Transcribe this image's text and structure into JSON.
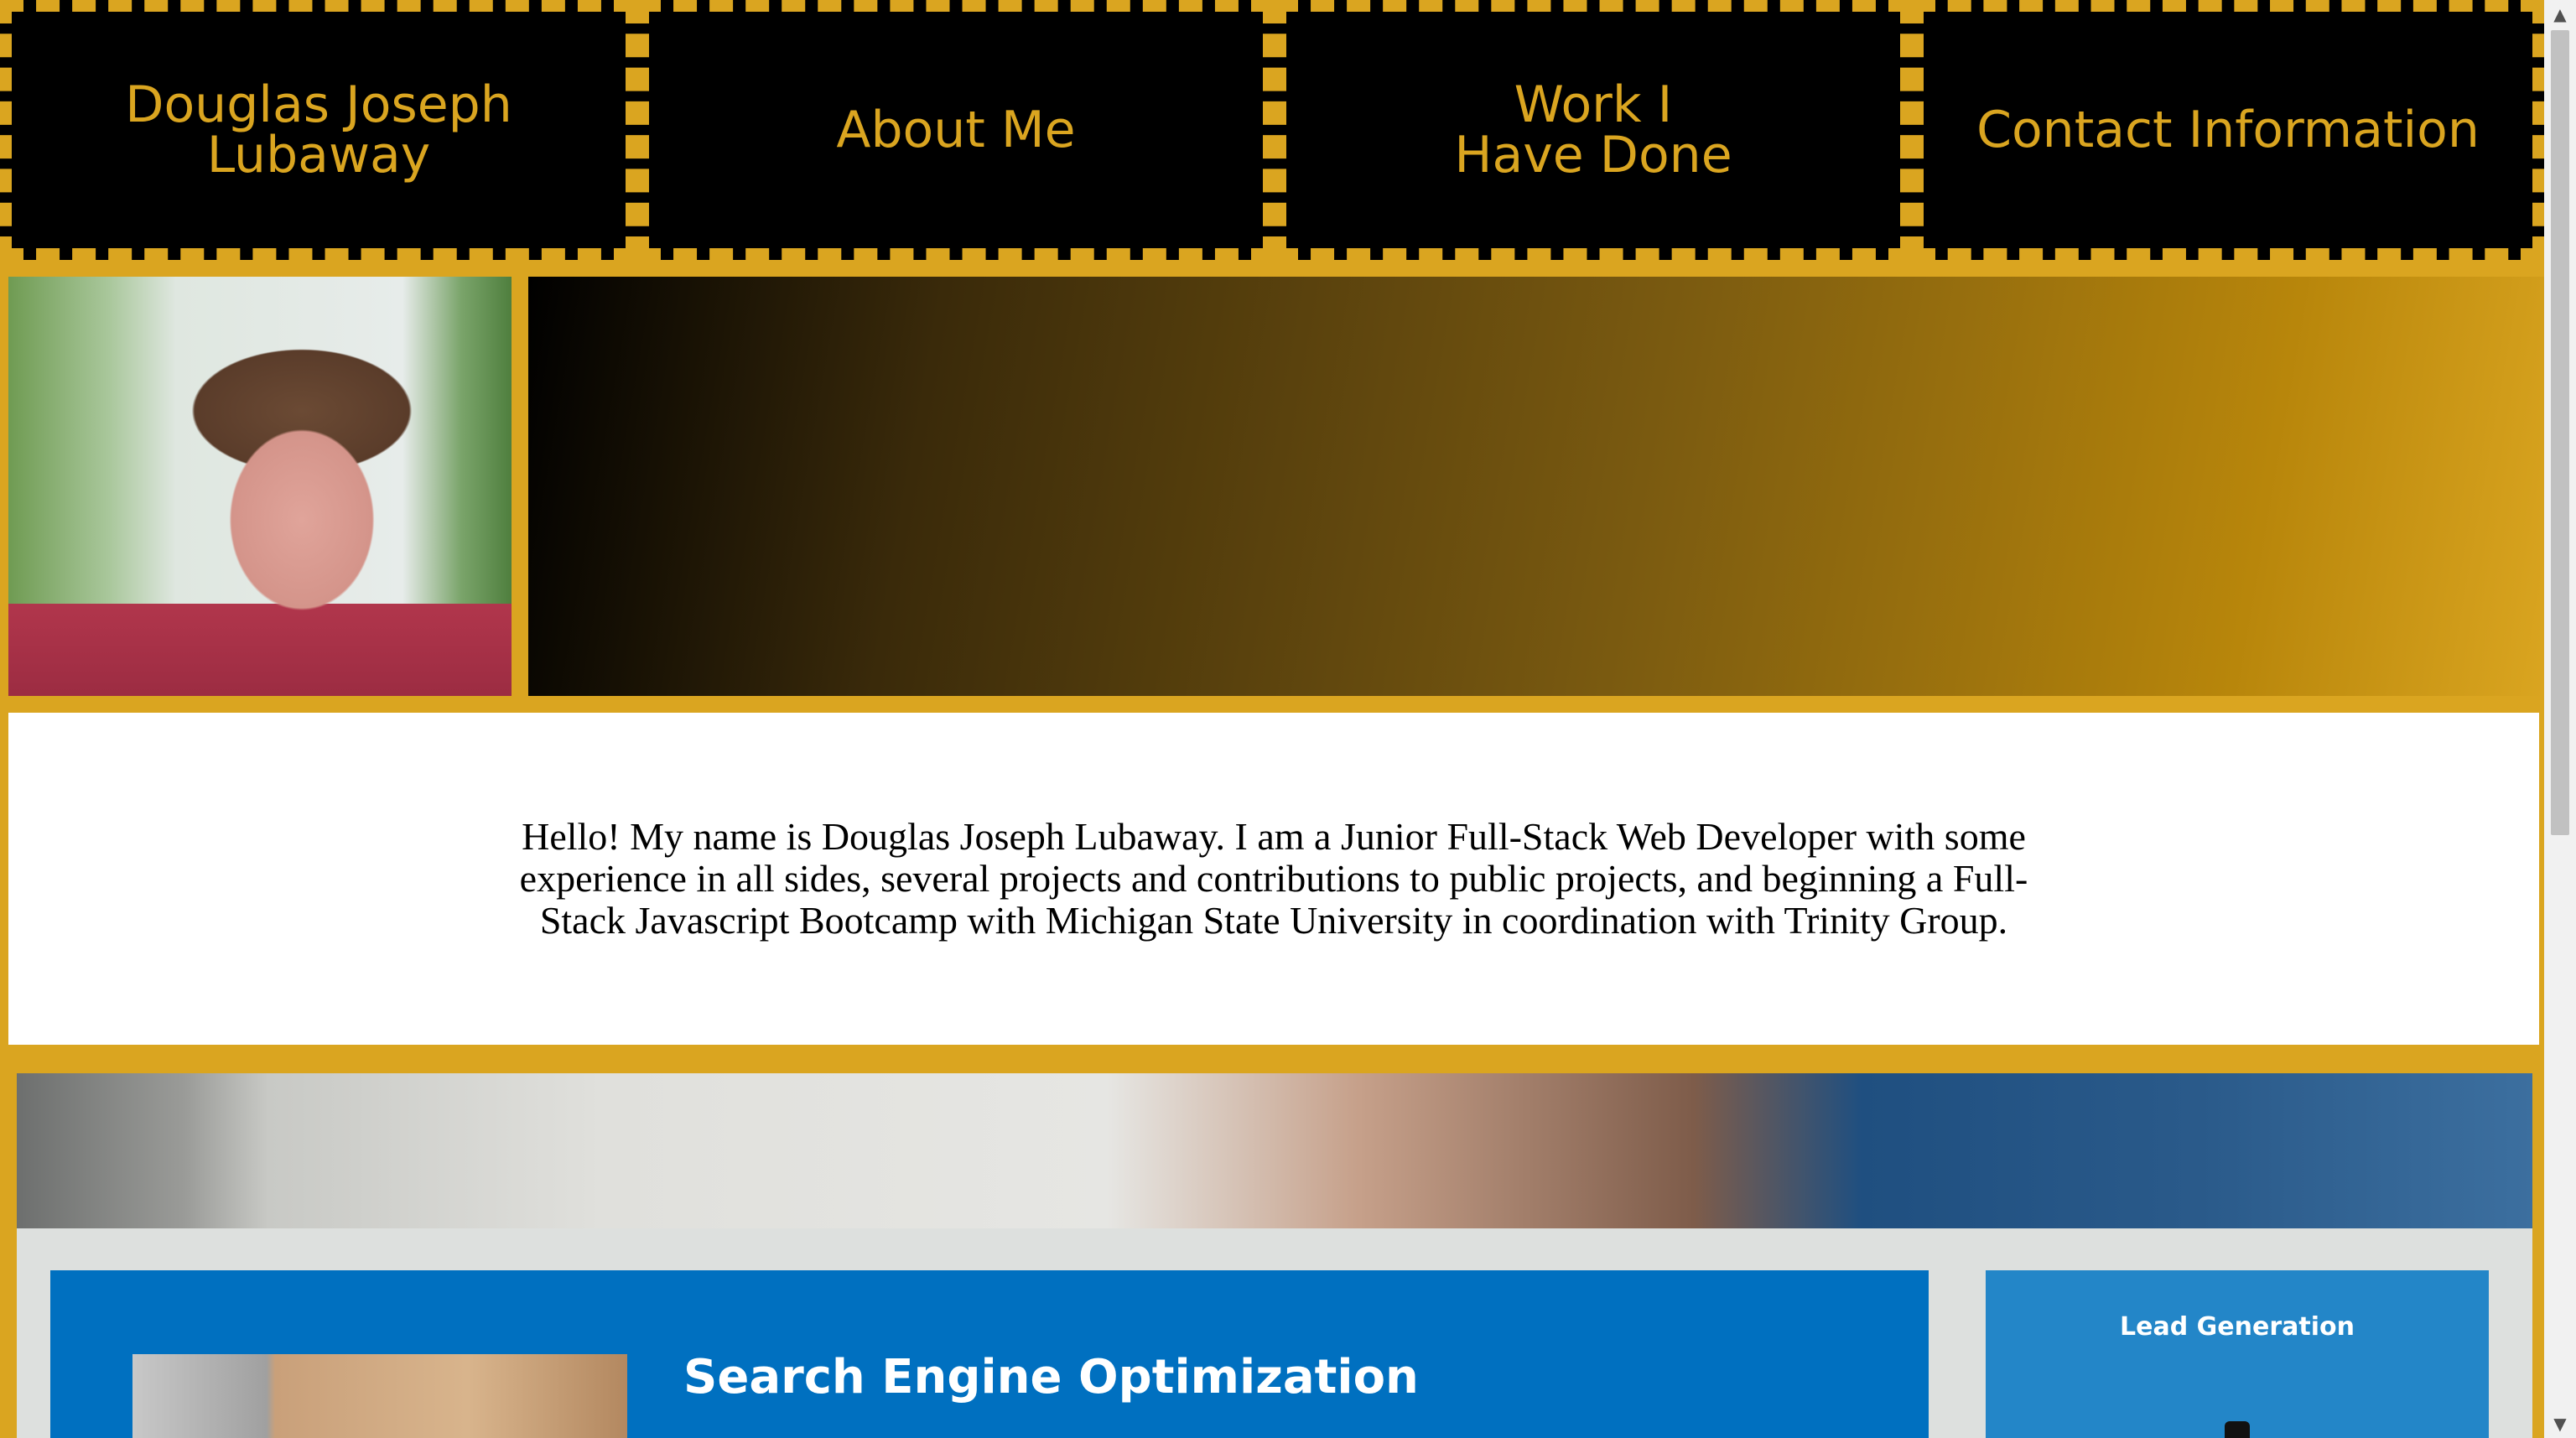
{
  "nav": {
    "items": [
      {
        "label": "Douglas Joseph\nLubaway"
      },
      {
        "label": "About Me"
      },
      {
        "label": "Work I\nHave Done"
      },
      {
        "label": "Contact Information"
      }
    ]
  },
  "intro": {
    "text": "Hello! My name is Douglas Joseph Lubaway. I am a Junior Full-Stack Web Developer with some experience in all sides, several projects and contributions to public projects, and beginning a Full-Stack Javascript Bootcamp with Michigan State University in coordination with Trinity Group."
  },
  "work": {
    "seo_title": "Search Engine Optimization",
    "lead_title": "Lead Generation"
  },
  "colors": {
    "accent": "#daa520",
    "nav_bg": "#000000",
    "seo_card": "#0070c0",
    "lead_card": "#2386c8"
  },
  "icons": {
    "scroll_up": "▲",
    "scroll_down": "▼"
  }
}
